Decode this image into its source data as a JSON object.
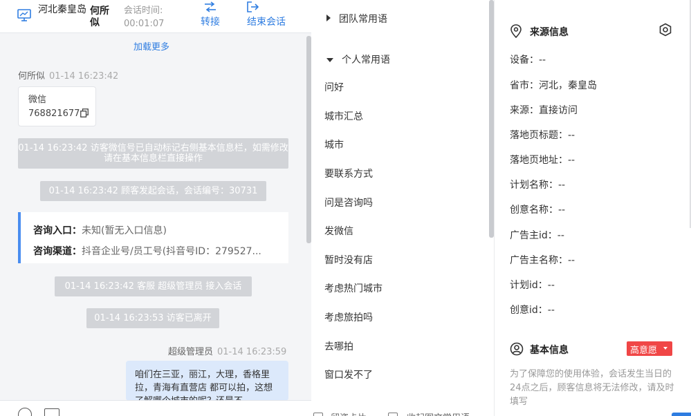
{
  "header": {
    "region": "河北秦皇岛",
    "visitor_name": "何所似",
    "session_time_label": "会话时间:",
    "session_time_value": "00:01:07",
    "transfer_label": "转接",
    "end_label": "结束会话"
  },
  "chat": {
    "load_more": "加载更多",
    "visitor_msg": {
      "sender": "何所似",
      "time": "01-14 16:23:42",
      "card_title": "微信",
      "card_value": "768821677"
    },
    "system": [
      "01-14 16:23:42 访客微信号已自动标记右侧基本信息栏，如需修改请在基本信息栏直接操作",
      "01-14 16:23:42 顾客发起会话，会话编号：30731",
      "01-14 16:23:42 客服 超级管理员 接入会话",
      "01-14 16:23:53 访客已离开"
    ],
    "consult": {
      "entry_label": "咨询入口：",
      "entry_value": "未知(暂无入口信息)",
      "channel_label": "咨询渠道：",
      "channel_value": "抖音企业号/员工号(抖音号ID：279527..."
    },
    "agent_msg": {
      "sender": "超级管理员",
      "time": "01-14 16:23:59",
      "text": "咱们在三亚，丽江，大理，香格里拉，青海有直营店 都可以拍，这想了解哪个城市的呢？还是不"
    }
  },
  "phrases": {
    "team_group": "团队常用语",
    "personal_group": "个人常用语",
    "items": [
      "问好",
      "城市汇总",
      "城市",
      "要联系方式",
      "问是咨询吗",
      "发微信",
      "暂时没有店",
      "考虑热门城市",
      "考虑旅拍吗",
      "去哪拍",
      "窗口发不了"
    ],
    "footer_left": "留资卡片",
    "footer_right": "收起图文常用语"
  },
  "info": {
    "source_title": "来源信息",
    "fields": [
      "设备：--",
      "省市：河北，秦皇岛",
      "来源：直接访问",
      "落地页标题：--",
      "落地页地址：--",
      "计划名称：--",
      "创意名称：--",
      "广告主id：--",
      "广告主名称：--",
      "计划id：--",
      "创意id：--"
    ],
    "basic_title": "基本信息",
    "intent_badge": "高意愿",
    "note": "为了保障您的使用体验，会话发生当日的24点之后，顾客信息将无法修改，请及时填写",
    "colors": {
      "accent": "#2f7de1",
      "badge": "#f04646",
      "agent_bubble": "#dce9fb",
      "system_msg": "#d2d4d8"
    }
  }
}
